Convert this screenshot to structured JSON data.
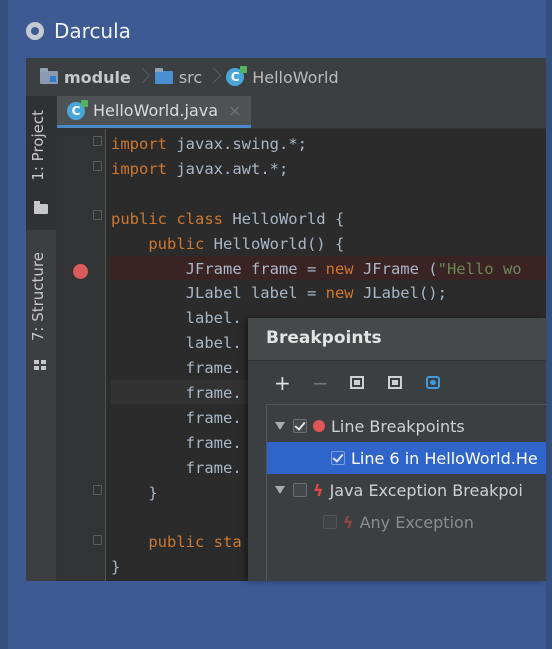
{
  "window": {
    "title": "Darcula"
  },
  "navbar": {
    "module": "module",
    "src": "src",
    "file": "HelloWorld"
  },
  "tool_tabs": {
    "project": "1: Project",
    "structure": "7: Structure"
  },
  "editor_tab": {
    "label": "HelloWorld.java",
    "close": "×"
  },
  "code_lines": [
    {
      "indent": "",
      "parts": [
        [
          "kw",
          "import"
        ],
        [
          "plain",
          " javax.swing.*;"
        ]
      ]
    },
    {
      "indent": "",
      "parts": [
        [
          "kw",
          "import"
        ],
        [
          "plain",
          " javax.awt.*;"
        ]
      ]
    },
    {
      "indent": "",
      "parts": []
    },
    {
      "indent": "",
      "parts": [
        [
          "kw",
          "public class"
        ],
        [
          "plain",
          " HelloWorld {"
        ]
      ]
    },
    {
      "indent": "    ",
      "parts": [
        [
          "kw",
          "public"
        ],
        [
          "plain",
          " HelloWorld() {"
        ]
      ]
    },
    {
      "indent": "        ",
      "parts": [
        [
          "plain",
          "JFrame frame = "
        ],
        [
          "kw",
          "new"
        ],
        [
          "plain",
          " JFrame ("
        ],
        [
          "str",
          "\"Hello wo"
        ]
      ]
    },
    {
      "indent": "        ",
      "parts": [
        [
          "plain",
          "JLabel label = "
        ],
        [
          "kw",
          "new"
        ],
        [
          "plain",
          " JLabel();"
        ]
      ]
    },
    {
      "indent": "        ",
      "parts": [
        [
          "plain",
          "label."
        ]
      ]
    },
    {
      "indent": "        ",
      "parts": [
        [
          "plain",
          "label."
        ]
      ]
    },
    {
      "indent": "        ",
      "parts": [
        [
          "plain",
          "frame."
        ]
      ]
    },
    {
      "indent": "        ",
      "parts": [
        [
          "plain",
          "frame."
        ]
      ]
    },
    {
      "indent": "        ",
      "parts": [
        [
          "plain",
          "frame."
        ]
      ]
    },
    {
      "indent": "        ",
      "parts": [
        [
          "plain",
          "frame."
        ]
      ]
    },
    {
      "indent": "        ",
      "parts": [
        [
          "plain",
          "frame."
        ]
      ]
    },
    {
      "indent": "    ",
      "parts": [
        [
          "plain",
          "}"
        ]
      ]
    },
    {
      "indent": "",
      "parts": []
    },
    {
      "indent": "    ",
      "parts": [
        [
          "kw",
          "public sta"
        ]
      ]
    },
    {
      "indent": "",
      "parts": [
        [
          "plain",
          "}"
        ]
      ]
    }
  ],
  "dialog": {
    "title": "Breakpoints",
    "toolbar": {
      "add": "+",
      "remove": "−"
    },
    "tree": {
      "line_breakpoints": "Line Breakpoints",
      "line_item": "Line 6 in HelloWorld.He",
      "java_exception": "Java Exception Breakpoi",
      "any_exception": "Any Exception"
    }
  }
}
